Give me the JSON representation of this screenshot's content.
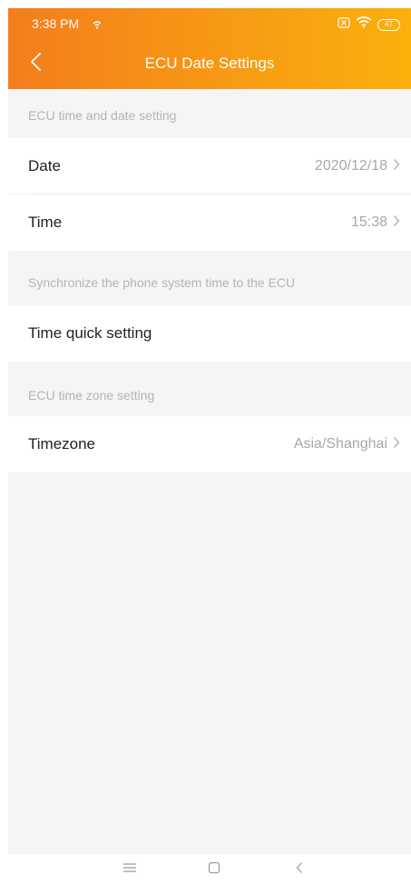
{
  "status": {
    "time": "3:38 PM",
    "battery": "47"
  },
  "nav": {
    "title": "ECU Date Settings"
  },
  "sections": [
    {
      "header": "ECU time and date setting",
      "rows": [
        {
          "label": "Date",
          "value": "2020/12/18"
        },
        {
          "label": "Time",
          "value": "15:38"
        }
      ]
    },
    {
      "header": "Synchronize the phone system time to the ECU",
      "rows": [
        {
          "label": "Time quick setting"
        }
      ]
    },
    {
      "header": "ECU time zone setting",
      "rows": [
        {
          "label": "Timezone",
          "value": "Asia/Shanghai"
        }
      ]
    }
  ],
  "colors": {
    "header_gradient_start": "#f47d1c",
    "header_gradient_end": "#fbb00c",
    "background": "#f5f5f5",
    "muted_text": "#b4b4b4"
  },
  "icons": {
    "back": "chevron-left-icon",
    "chevron": "chevron-right-icon",
    "menu": "menu-icon",
    "home": "home-square-icon",
    "system_back": "system-back-icon"
  }
}
